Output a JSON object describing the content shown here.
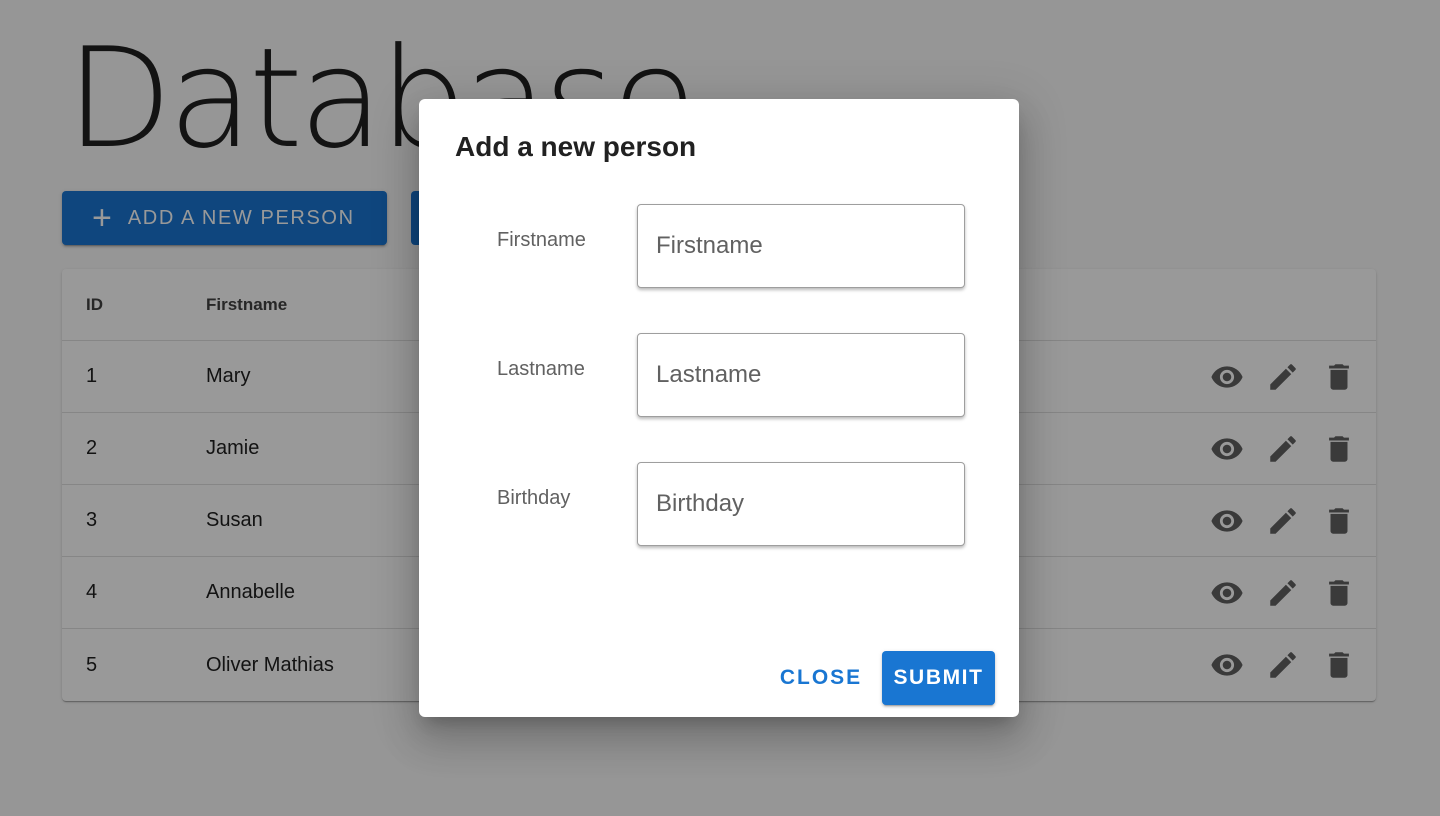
{
  "page": {
    "title": "Database",
    "add_button_label": "ADD A NEW PERSON",
    "add_button_icon": "plus-icon"
  },
  "table": {
    "headers": {
      "id": "ID",
      "firstname": "Firstname"
    },
    "rows": [
      {
        "id": "1",
        "firstname": "Mary"
      },
      {
        "id": "2",
        "firstname": "Jamie"
      },
      {
        "id": "3",
        "firstname": "Susan"
      },
      {
        "id": "4",
        "firstname": "Annabelle"
      },
      {
        "id": "5",
        "firstname": "Oliver Mathias"
      }
    ],
    "row_action_icons": [
      "eye-icon",
      "pencil-icon",
      "trash-icon"
    ]
  },
  "dialog": {
    "title": "Add a new person",
    "fields": [
      {
        "label": "Firstname",
        "placeholder": "Firstname",
        "value": ""
      },
      {
        "label": "Lastname",
        "placeholder": "Lastname",
        "value": ""
      },
      {
        "label": "Birthday",
        "placeholder": "Birthday",
        "value": ""
      }
    ],
    "close_label": "CLOSE",
    "submit_label": "SUBMIT"
  },
  "colors": {
    "primary": "#1976d2",
    "backdrop": "rgba(0,0,0,0.4)",
    "icon": "#616161"
  }
}
